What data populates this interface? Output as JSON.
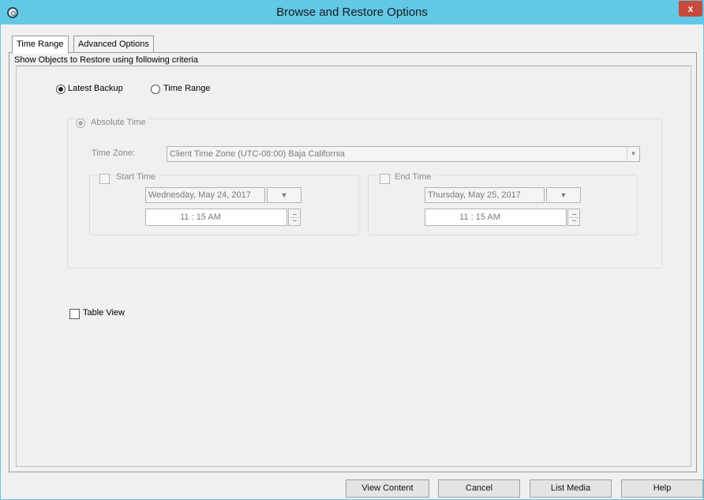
{
  "window": {
    "title": "Browse and Restore Options",
    "close_label": "x"
  },
  "tabs": [
    {
      "label": "Time Range",
      "active": true
    },
    {
      "label": "Advanced Options",
      "active": false
    }
  ],
  "criteria_label": "Show Objects to Restore using following criteria",
  "mode": {
    "latest_backup_label": "Latest Backup",
    "time_range_label": "Time Range",
    "selected": "Latest Backup"
  },
  "absolute_time": {
    "label": "Absolute Time",
    "time_zone_label": "Time Zone:",
    "time_zone_value": "Client Time Zone (UTC-08:00) Baja California",
    "start": {
      "label": "Start Time",
      "checked": false,
      "date": "Wednesday, May 24, 2017",
      "time": "11 : 15 AM"
    },
    "end": {
      "label": "End Time",
      "checked": false,
      "date": "Thursday, May 25, 2017",
      "time": "11 : 15 AM"
    }
  },
  "table_view": {
    "label": "Table View",
    "checked": false
  },
  "buttons": {
    "view_content": "View Content",
    "cancel": "Cancel",
    "list_media": "List Media",
    "help": "Help"
  }
}
